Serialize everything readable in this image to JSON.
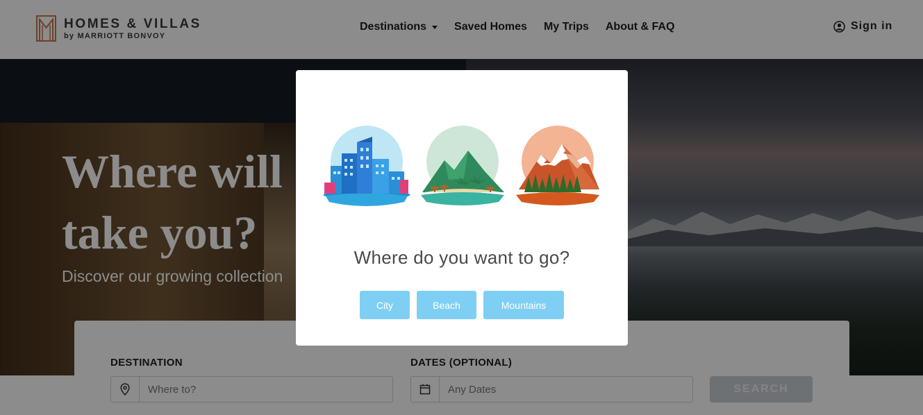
{
  "brand": {
    "name_line1": "HOMES & VILLAS",
    "name_line2": "by MARRIOTT BONVOY"
  },
  "nav": {
    "items": [
      {
        "label": "Destinations",
        "has_dropdown": true
      },
      {
        "label": "Saved Homes"
      },
      {
        "label": "My Trips"
      },
      {
        "label": "About & FAQ"
      }
    ],
    "sign_in": "Sign in"
  },
  "hero": {
    "title_line1": "Where will",
    "title_line2": "take you?",
    "subtitle": "Discover our growing collection"
  },
  "search": {
    "destination_label": "DESTINATION",
    "destination_placeholder": "Where to?",
    "dates_label": "DATES (OPTIONAL)",
    "dates_placeholder": "Any Dates",
    "button": "SEARCH"
  },
  "modal": {
    "title": "Where do you want to go?",
    "choices": [
      "City",
      "Beach",
      "Mountains"
    ]
  },
  "colors": {
    "choice_button": "#7fcff5",
    "logo_accent": "#c8754a",
    "search_button_disabled": "#c9ced4"
  }
}
